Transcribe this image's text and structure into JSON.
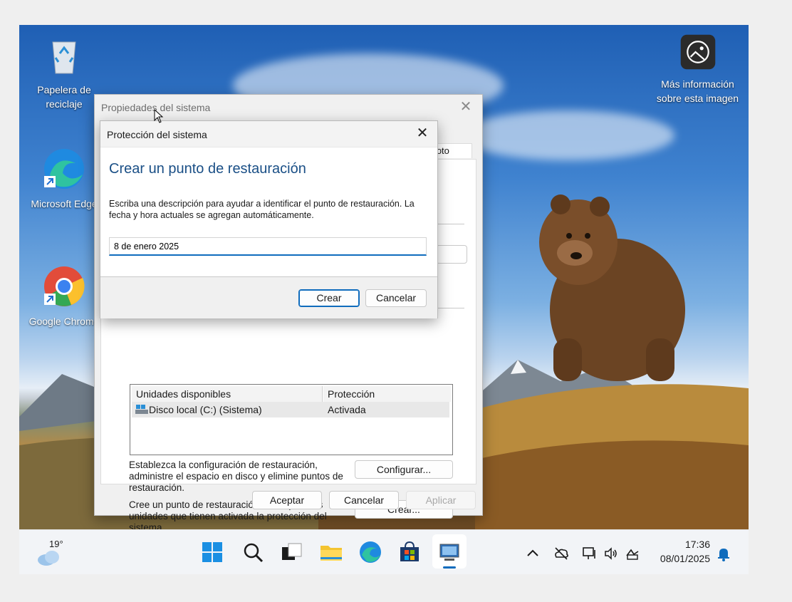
{
  "desktop": {
    "icons": {
      "recycle": "Papelera de reciclaje",
      "edge": "Microsoft Edge",
      "chrome": "Google Chrome",
      "info": "Más información sobre esta imagen"
    }
  },
  "sysprops": {
    "title": "Propiedades del sistema",
    "tab_remote": "moto",
    "table": {
      "col_drives": "Unidades disponibles",
      "col_protection": "Protección",
      "rows": [
        {
          "drive": "Disco local (C:) (Sistema)",
          "protection": "Activada"
        }
      ]
    },
    "configure_text": "Establezca la configuración de restauración, administre el espacio en disco y elimine puntos de restauración.",
    "configure_button": "Configurar...",
    "create_text": "Cree un punto de restauración ahora para las unidades que tienen activada la protección del sistema.",
    "create_button": "Crear...",
    "ok_button": "Aceptar",
    "cancel_button": "Cancelar",
    "apply_button": "Aplicar"
  },
  "restore_dialog": {
    "title": "Protección del sistema",
    "heading": "Crear un punto de restauración",
    "description": "Escriba una descripción para ayudar a identificar el punto de restauración. La fecha y hora actuales se agregan automáticamente.",
    "input_value": "8 de enero 2025",
    "create_button": "Crear",
    "cancel_button": "Cancelar"
  },
  "taskbar": {
    "weather_temp": "19°",
    "time": "17:36",
    "date": "08/01/2025"
  },
  "colors": {
    "accent": "#0f6cbd",
    "heading_blue": "#1a4f86"
  }
}
